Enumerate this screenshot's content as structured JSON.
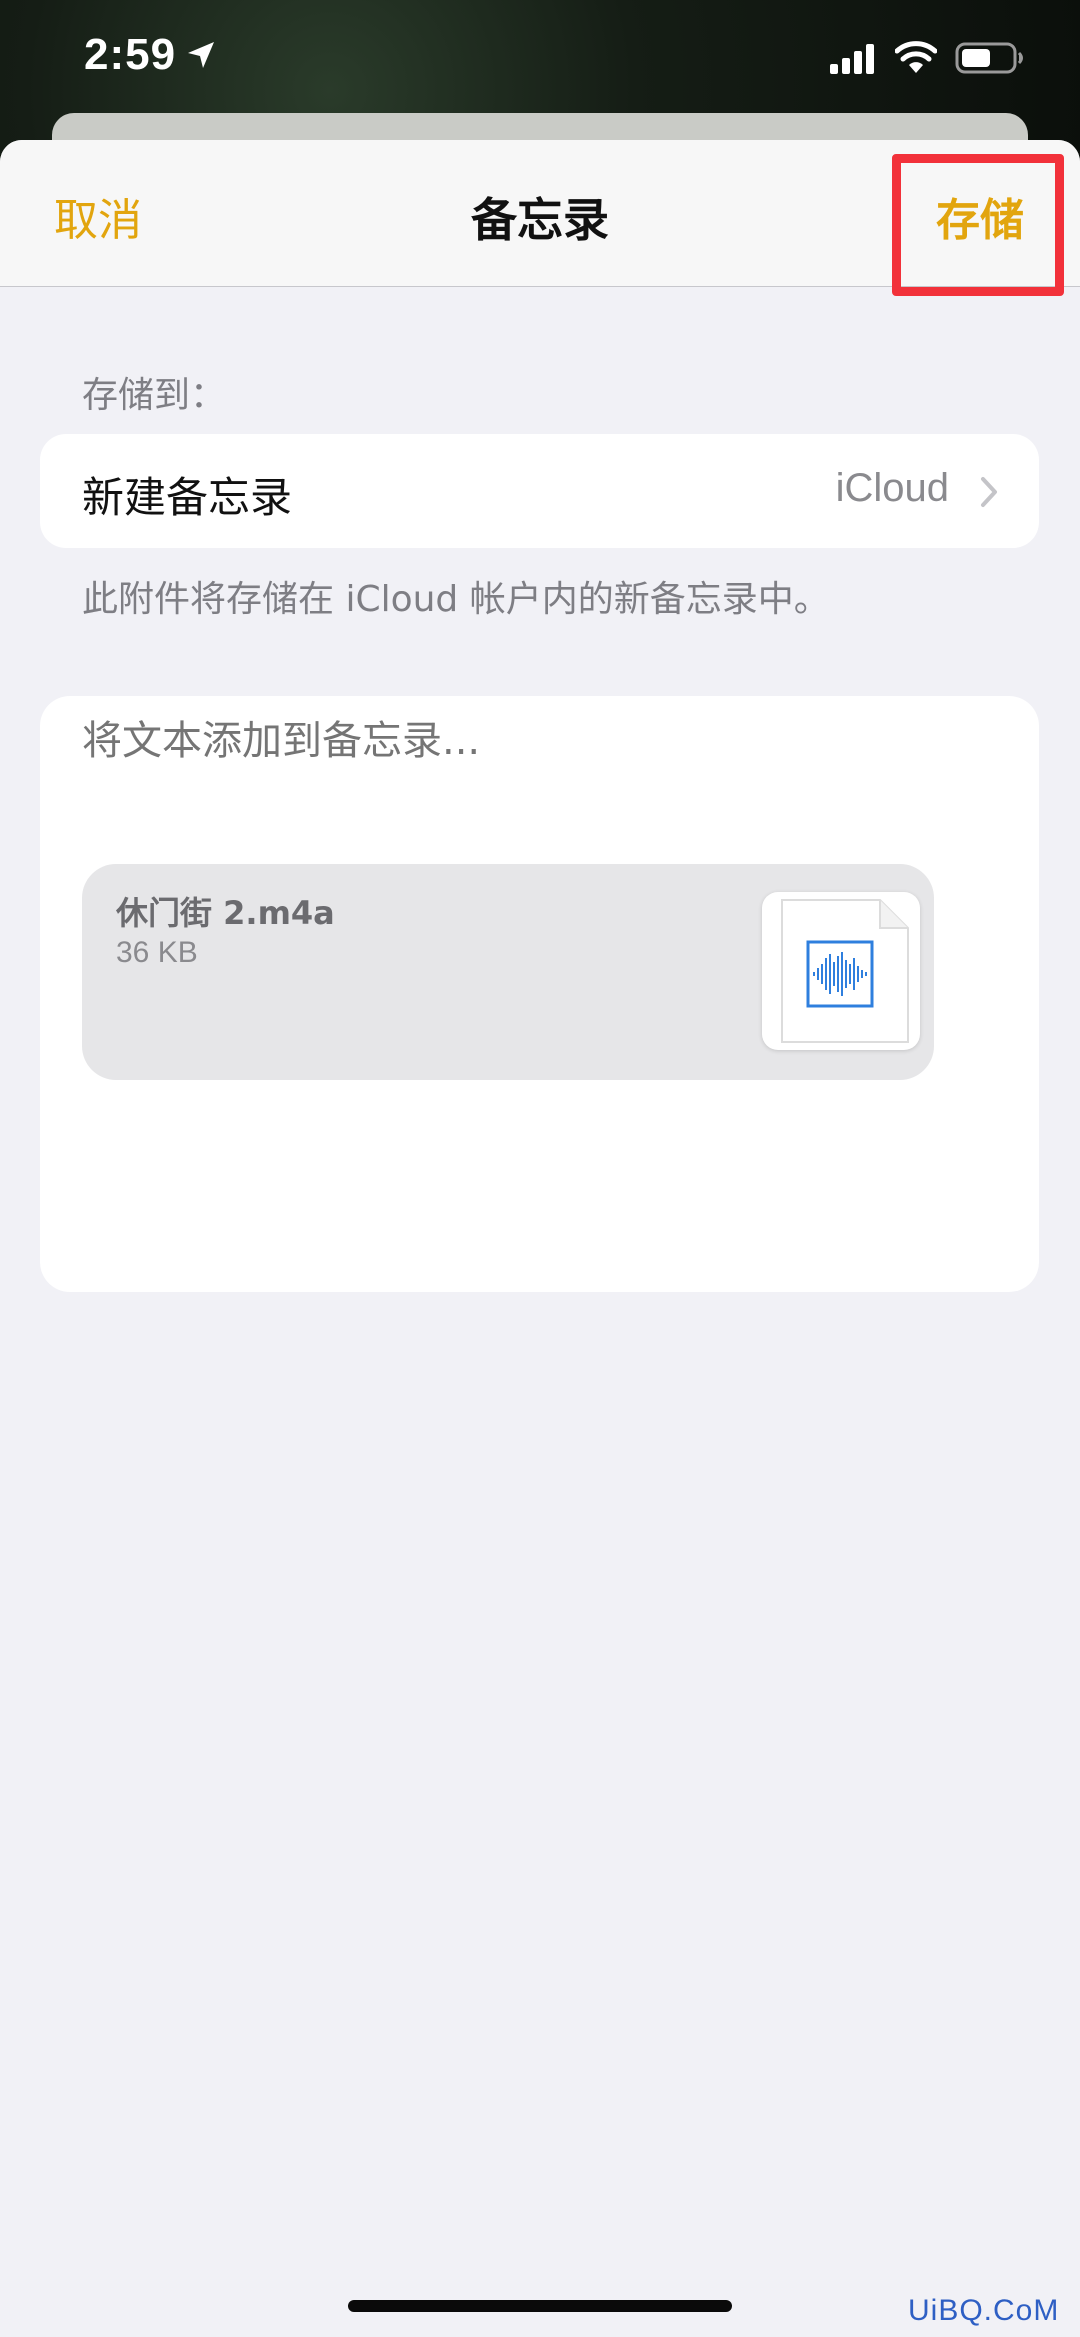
{
  "status_bar": {
    "time": "2:59"
  },
  "nav": {
    "cancel_label": "取消",
    "title": "备忘录",
    "save_label": "存储"
  },
  "destination": {
    "section_label": "存储到：",
    "row_label": "新建备忘录",
    "account": "iCloud",
    "footnote": "此附件将存储在 iCloud 帐户内的新备忘录中。"
  },
  "note": {
    "placeholder": "将文本添加到备忘录...",
    "attachment": {
      "name": "休门街 2.m4a",
      "size": "36 KB",
      "icon": "audio-file-icon"
    }
  },
  "watermark": "UiBQ.CoM",
  "colors": {
    "accent": "#e2a50e",
    "highlight": "#f2313a",
    "background": "#f1f1f6",
    "audio_blue": "#2f7fde"
  }
}
